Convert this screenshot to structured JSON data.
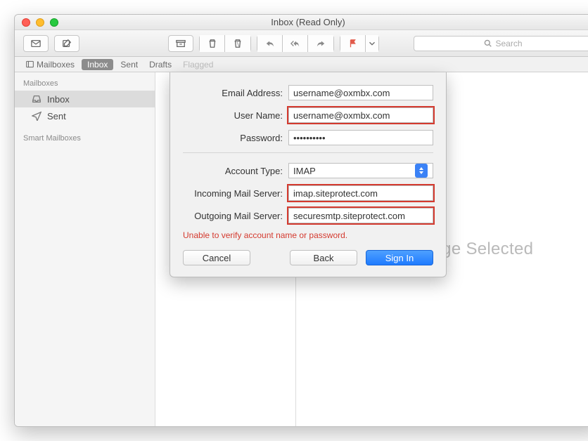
{
  "window": {
    "title": "Inbox (Read Only)"
  },
  "toolbar": {
    "search_placeholder": "Search"
  },
  "favbar": {
    "mailboxes": "Mailboxes",
    "inbox": "Inbox",
    "sent": "Sent",
    "drafts": "Drafts",
    "flagged": "Flagged"
  },
  "sidebar": {
    "header1": "Mailboxes",
    "inbox": "Inbox",
    "sent": "Sent",
    "header2": "Smart Mailboxes"
  },
  "preview": {
    "placeholder": "No Message Selected"
  },
  "sheet": {
    "labels": {
      "email": "Email Address:",
      "user": "User Name:",
      "password": "Password:",
      "account_type": "Account Type:",
      "incoming": "Incoming Mail Server:",
      "outgoing": "Outgoing Mail Server:"
    },
    "values": {
      "email": "username@oxmbx.com",
      "user": "username@oxmbx.com",
      "password": "••••••••••",
      "account_type": "IMAP",
      "incoming": "imap.siteprotect.com",
      "outgoing": "securesmtp.siteprotect.com"
    },
    "error": "Unable to verify account name or password.",
    "buttons": {
      "cancel": "Cancel",
      "back": "Back",
      "signin": "Sign In"
    }
  }
}
